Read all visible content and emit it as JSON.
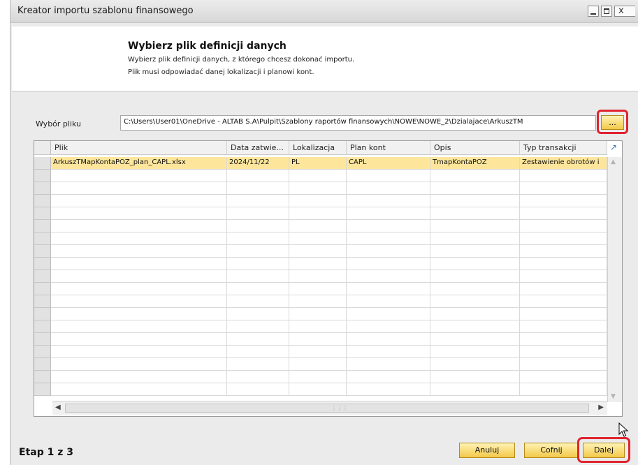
{
  "window": {
    "title": "Kreator importu szablonu finansowego",
    "close_glyph": "x"
  },
  "header": {
    "title": "Wybierz plik definicji danych",
    "line1": "Wybierz plik definicji danych, z którego chcesz dokonać importu.",
    "line2": "Plik musi odpowiadać danej lokalizacji i planowi kont."
  },
  "file_select": {
    "label": "Wybór pliku",
    "path": "C:\\Users\\User01\\OneDrive - ALTAB S.A\\Pulpit\\Szablony raportów finansowych\\NOWE\\NOWE_2\\Dzialajace\\ArkuszTM",
    "browse_label": "..."
  },
  "grid": {
    "columns": [
      "Plik",
      "Data zatwie...",
      "Lokalizacja",
      "Plan kont",
      "Opis",
      "Typ transakcji"
    ],
    "rows": [
      [
        "ArkuszTMapKontaPOZ_plan_CAPL.xlsx",
        "2024/11/22",
        "PL",
        "CAPL",
        "TmapKontaPOZ",
        "Zestawienie obrotów i"
      ]
    ]
  },
  "footer": {
    "step": "Etap 1 z 3",
    "cancel": "Anuluj",
    "back": "Cofnij",
    "next": "Dalej"
  },
  "colors": {
    "selected_row": "#fde69c",
    "button": "#f3c847",
    "highlight": "#e0242f"
  }
}
